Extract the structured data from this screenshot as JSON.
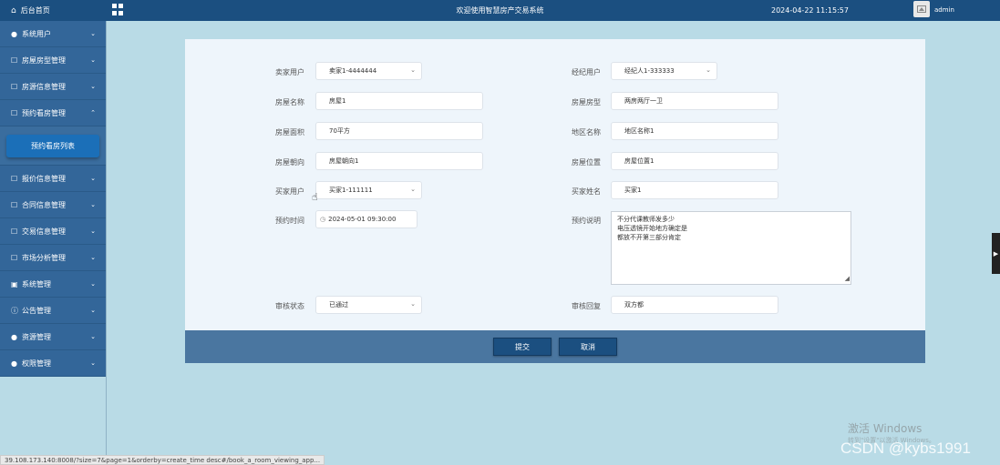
{
  "topbar": {
    "home_label": "后台首页",
    "title": "欢迎使用智慧房产交易系统",
    "datetime": "2024-04-22 11:15:57",
    "username": "admin"
  },
  "sidebar": {
    "items": [
      {
        "label": "系统用户",
        "icon": "user-icon"
      },
      {
        "label": "房屋房型管理",
        "icon": "edit-icon"
      },
      {
        "label": "房源信息管理",
        "icon": "edit-icon"
      },
      {
        "label": "预约看房管理",
        "icon": "edit-icon",
        "expanded": true
      },
      {
        "label": "报价信息管理",
        "icon": "edit-icon"
      },
      {
        "label": "合同信息管理",
        "icon": "edit-icon"
      },
      {
        "label": "交易信息管理",
        "icon": "edit-icon"
      },
      {
        "label": "市场分析管理",
        "icon": "edit-icon"
      },
      {
        "label": "系统管理",
        "icon": "image-icon"
      },
      {
        "label": "公告管理",
        "icon": "info-icon"
      },
      {
        "label": "资源管理",
        "icon": "pin-icon"
      },
      {
        "label": "权限管理",
        "icon": "user-icon"
      }
    ],
    "submenu_label": "预约看房列表"
  },
  "form": {
    "seller_user": {
      "label": "卖家用户",
      "value": "卖家1-4444444"
    },
    "agent_user": {
      "label": "经纪用户",
      "value": "经纪人1-333333"
    },
    "house_name": {
      "label": "房屋名称",
      "value": "房屋1"
    },
    "house_type": {
      "label": "房屋房型",
      "value": "两房两厅一卫"
    },
    "house_area": {
      "label": "房屋面积",
      "value": "70平方"
    },
    "region_name": {
      "label": "地区名称",
      "value": "地区名称1"
    },
    "house_orientation": {
      "label": "房屋朝向",
      "value": "房屋朝向1"
    },
    "house_location": {
      "label": "房屋位置",
      "value": "房屋位置1"
    },
    "buyer_user": {
      "label": "买家用户",
      "value": "买家1-111111"
    },
    "buyer_name": {
      "label": "买家姓名",
      "value": "买家1"
    },
    "appointment_time": {
      "label": "预约时间",
      "value": "2024-05-01 09:30:00"
    },
    "appointment_note": {
      "label": "预约说明",
      "lines": [
        "不分代课教师发多少",
        "电压透镜开始地方确定是",
        "都放不开第三部分肯定"
      ]
    },
    "review_status": {
      "label": "审核状态",
      "value": "已通过"
    },
    "review_reply": {
      "label": "审核回复",
      "value": "双方都"
    },
    "submit_label": "提交",
    "cancel_label": "取消"
  },
  "statusbar": {
    "url": "39.108.173.140:8008/?size=7&page=1&orderby=create_time desc#/book_a_room_viewing_app..."
  },
  "watermarks": {
    "windows_title": "激活 Windows",
    "windows_sub": "转到\"设置\"以激活 Windows。",
    "csdn": "CSDN @kybs1991"
  },
  "colors": {
    "topbar": "#1b4f80",
    "sidebar": "#336699",
    "background": "#b9dbe6",
    "card": "#eef5fb",
    "button": "#1b4f80"
  }
}
